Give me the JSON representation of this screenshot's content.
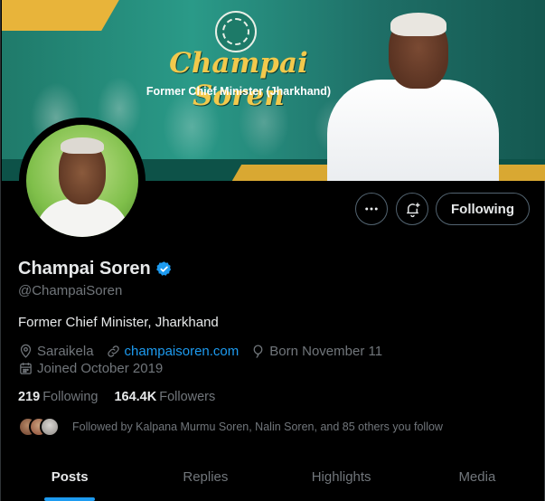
{
  "banner": {
    "title": "Champai Soren",
    "subtitle": "Former Chief Minister (Jharkhand)"
  },
  "profile": {
    "display_name": "Champai Soren",
    "handle": "@ChampaiSoren",
    "bio": "Former Chief Minister, Jharkhand",
    "location": "Saraikela",
    "website": "champaisoren.com",
    "birthday": "Born November 11",
    "joined": "Joined October 2019",
    "verified_color": "#1d9bf0"
  },
  "actions": {
    "more_icon": "more-horizontal-icon",
    "notify_icon": "bell-plus-icon",
    "follow_label": "Following"
  },
  "counts": {
    "following_value": "219",
    "following_label": "Following",
    "followers_value": "164.4K",
    "followers_label": "Followers"
  },
  "followed_by": {
    "text": "Followed by Kalpana Murmu Soren, Nalin Soren, and 85 others you follow"
  },
  "tabs": [
    {
      "label": "Posts",
      "active": true
    },
    {
      "label": "Replies",
      "active": false
    },
    {
      "label": "Highlights",
      "active": false
    },
    {
      "label": "Media",
      "active": false
    }
  ],
  "colors": {
    "accent": "#1d9bf0",
    "background": "#000000",
    "text_primary": "#e7e9ea",
    "text_secondary": "#71767b",
    "banner_gold": "#f2c94c",
    "banner_teal": "#1f7a6a"
  }
}
